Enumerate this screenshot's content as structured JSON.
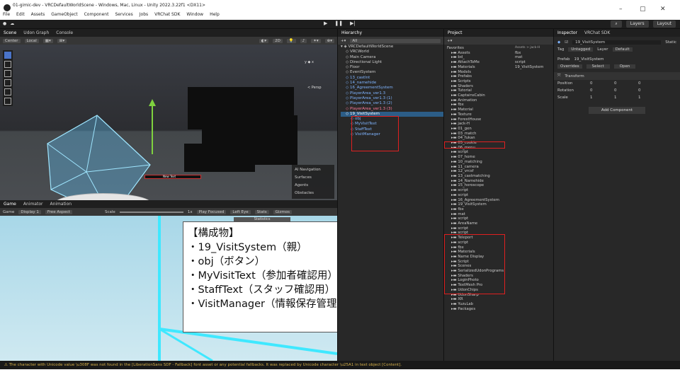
{
  "window": {
    "title": "01-gimic-dev - VRCDefaultWorldScene - Windows, Mac, Linux - Unity 2022.3.22f1 <DX11>",
    "menu": [
      "File",
      "Edit",
      "Assets",
      "GameObject",
      "Component",
      "Services",
      "Jobs",
      "VRChat SDK",
      "Window",
      "Help"
    ],
    "controls": [
      "–",
      "▢",
      "✕"
    ]
  },
  "toolbar": {
    "account": "●",
    "layers_label": "Layers",
    "layout_label": "Layout"
  },
  "scene": {
    "tabs": [
      "Scene",
      "Udon Graph",
      "Console"
    ],
    "pivot": "Center",
    "space": "Local",
    "mode_2d": "2D",
    "nav_panel": [
      "AI Navigation",
      "Surfaces",
      "Agents",
      "Obstacles"
    ],
    "persp_label": "< Persp",
    "new_text": "New Text"
  },
  "game": {
    "tabs": [
      "Game",
      "Animator",
      "Animation"
    ],
    "display": "Game",
    "display_num": "Display 1",
    "aspect": "Free Aspect",
    "scale_label": "Scale",
    "scale_value": "1x",
    "play_focused": "Play Focused",
    "eye": "Left Eye",
    "stats": "Stats",
    "gizmos": "Gizmos",
    "statistics": "Statistics"
  },
  "callout": {
    "lines": [
      "【構成物】",
      "・19_VisitSystem（親）",
      "・obj（ボタン）",
      "・MyVisitText（参加者確認用）",
      "・StaffText（スタッフ確認用）",
      "・VisitManager（情報保存管理）"
    ]
  },
  "hierarchy": {
    "tab": "Hierarchy",
    "search": "All",
    "items": [
      {
        "label": "VRCDefaultWorldScene",
        "indent": 0,
        "style": "root"
      },
      {
        "label": "VRCWorld",
        "indent": 1,
        "style": ""
      },
      {
        "label": "Main Camera",
        "indent": 1,
        "style": ""
      },
      {
        "label": "Directional Light",
        "indent": 1,
        "style": ""
      },
      {
        "label": "Floor",
        "indent": 1,
        "style": ""
      },
      {
        "label": "EventSystem",
        "indent": 1,
        "style": ""
      },
      {
        "label": "13_castlnt",
        "indent": 1,
        "style": "blue"
      },
      {
        "label": "14_namehide",
        "indent": 1,
        "style": "blue"
      },
      {
        "label": "16_AgreementSystem",
        "indent": 1,
        "style": "blue"
      },
      {
        "label": "PlayerArea_ver1.3",
        "indent": 1,
        "style": "blue"
      },
      {
        "label": "PlayerArea_ver1.3 (1)",
        "indent": 1,
        "style": "blue"
      },
      {
        "label": "PlayerArea_ver1.3 (2)",
        "indent": 1,
        "style": "blue"
      },
      {
        "label": "PlayerArea_ver1.3 (3)",
        "indent": 1,
        "style": "pink"
      },
      {
        "label": "19_VisitSystem",
        "indent": 1,
        "style": "sel"
      },
      {
        "label": "obj",
        "indent": 2,
        "style": "blue"
      },
      {
        "label": "MyVisitText",
        "indent": 2,
        "style": "blue"
      },
      {
        "label": "StaffText",
        "indent": 2,
        "style": "blue"
      },
      {
        "label": "VisitManager",
        "indent": 2,
        "style": "blue"
      }
    ]
  },
  "project": {
    "tab": "Project",
    "favorites": "Favorites",
    "breadcrumb": "Assets > jack-H",
    "tree": [
      "Assets",
      "bd_",
      "AttachToMe",
      "Materials",
      "Models",
      "Prefabs",
      "Scripts",
      "Shaders",
      "Tutorial",
      "CaptainsCabin",
      "Animation",
      "fbx",
      "Material",
      "Texture",
      "ForestHouse",
      "jack-H",
      "01_gen",
      "03_match",
      "04_fukan",
      "05_cookie",
      "06_menu",
      "script",
      "07_home",
      "10_matching",
      "11_camera",
      "12_vrcsf",
      "13_castmatching",
      "14_Namehide",
      "15_horoscope",
      "script",
      "script",
      "16_AgreementSystem",
      "19_VisitSystem",
      "fbx",
      "mat",
      "script",
      "AreaName",
      "script",
      "script",
      "Teleport",
      "script",
      "fbx",
      "Materials",
      "Name Display",
      "Script",
      "Scenes",
      "SerializedUdonPrograms",
      "Shaders",
      "LoginPhoto",
      "TextMesh Pro",
      "UdonChips",
      "UdonSharp",
      "XR",
      "YuzuLab",
      "Packages"
    ],
    "grid": [
      "fbx",
      "mat",
      "script",
      "19_VisitSystem"
    ]
  },
  "inspector": {
    "tabs": [
      "Inspector",
      "VRChat SDK"
    ],
    "object_name": "19_VisitSystem",
    "static": "Static",
    "tag_label": "Tag",
    "tag_value": "Untagged",
    "layer_label": "Layer",
    "layer_value": "Default",
    "prefab_label": "Prefab",
    "prefab_value": "19_VisitSystem",
    "overrides": "Overrides",
    "select": "Select",
    "open": "Open",
    "transform": "Transform",
    "rows": [
      {
        "label": "Position",
        "x": "0",
        "y": "0",
        "z": "0"
      },
      {
        "label": "Rotation",
        "x": "0",
        "y": "0",
        "z": "0"
      },
      {
        "label": "Scale",
        "x": "1",
        "y": "1",
        "z": "1"
      }
    ],
    "add_component": "Add Component"
  },
  "status": {
    "message": "The character with Unicode value \\u308F was not found in the [LiberationSans SDF - Fallback] font asset or any potential fallbacks. It was replaced by Unicode character \\u25A1 in text object [Content]."
  },
  "colors": {
    "accent_blue": "#2c5d87",
    "highlight_red": "#e02020",
    "prefab_blue": "#7fb4ff",
    "warning": "#d8b24a"
  }
}
